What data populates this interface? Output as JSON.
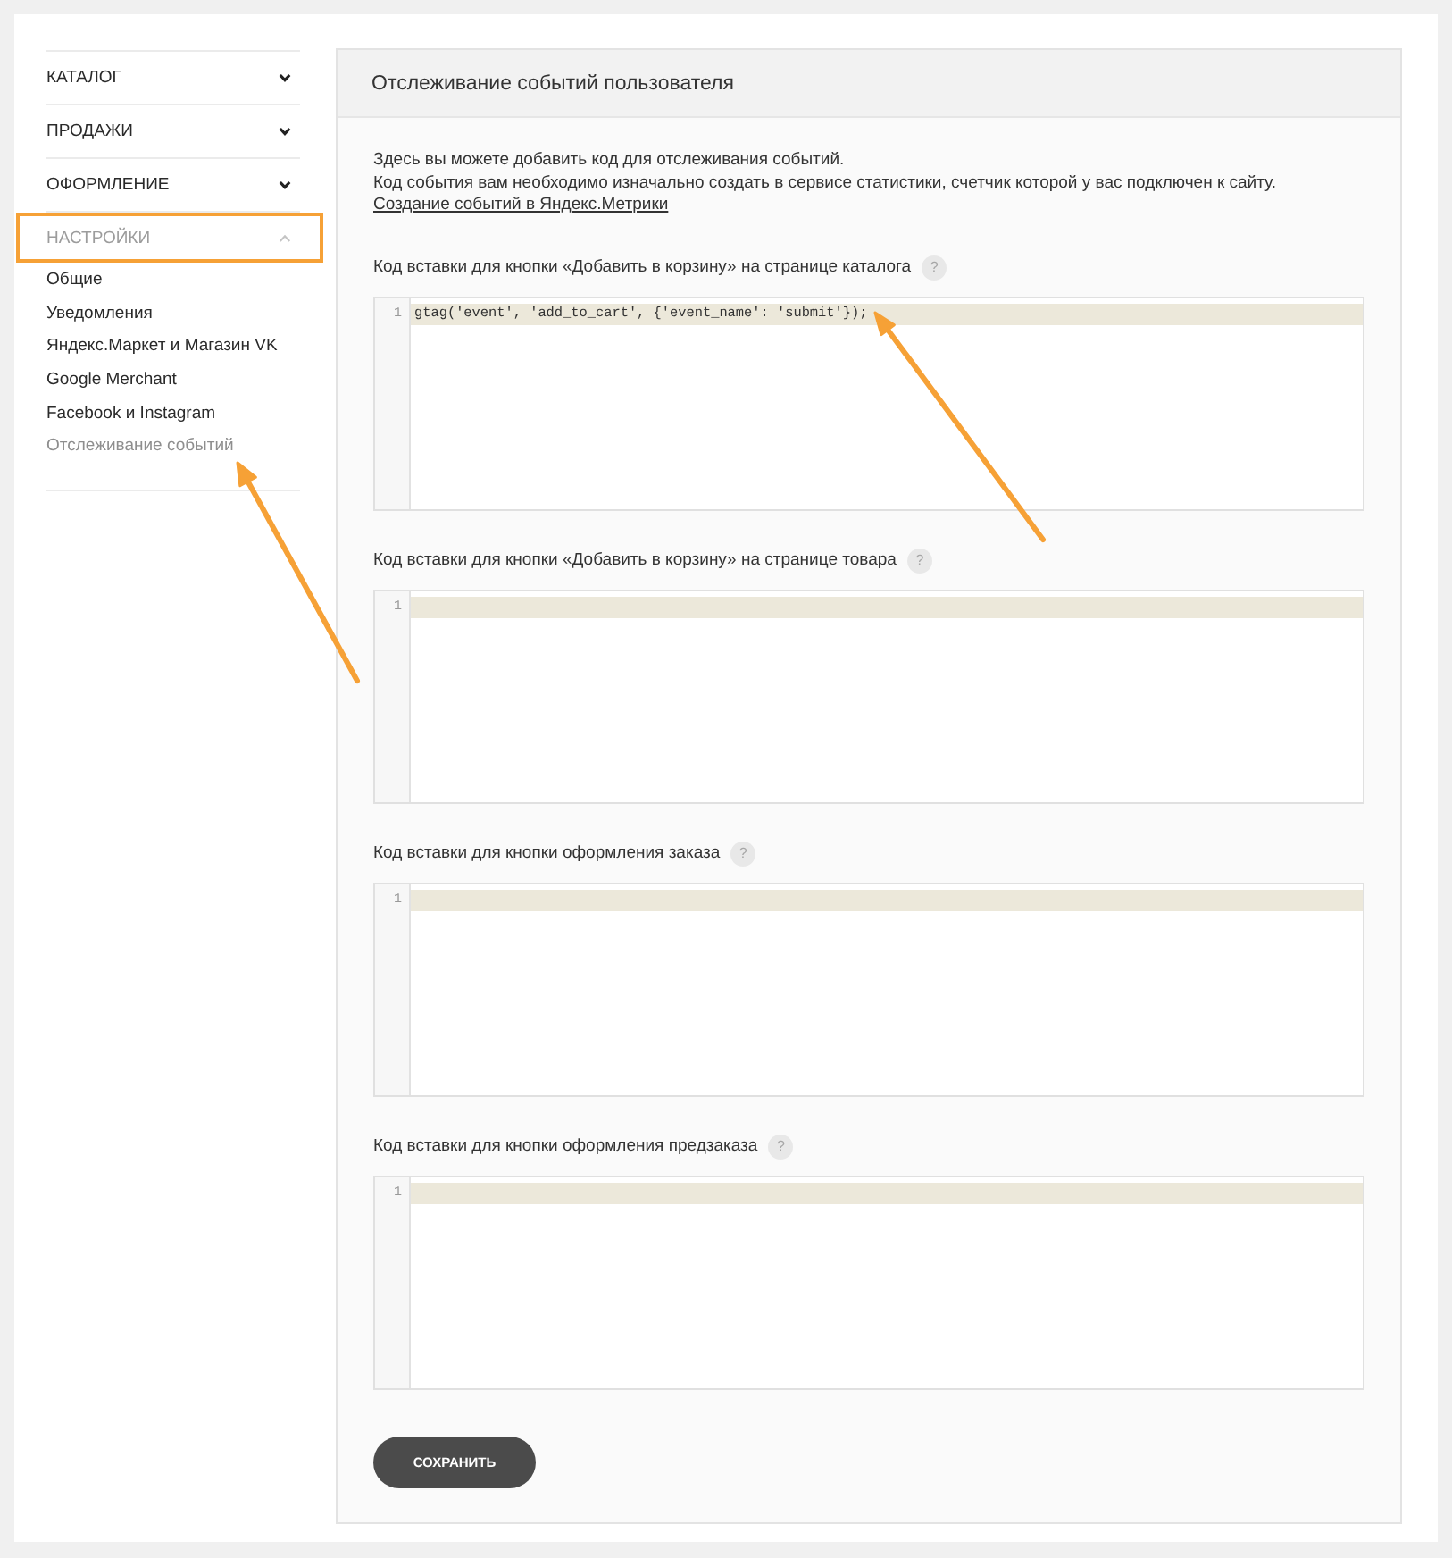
{
  "sidebar": {
    "sections": [
      {
        "label": "КАТАЛОГ",
        "expanded": false,
        "highlighted": false
      },
      {
        "label": "ПРОДАЖИ",
        "expanded": false,
        "highlighted": false
      },
      {
        "label": "ОФОРМЛЕНИЕ",
        "expanded": false,
        "highlighted": false
      },
      {
        "label": "НАСТРОЙКИ",
        "expanded": true,
        "highlighted": true,
        "items": [
          {
            "label": "Общие",
            "selected": false,
            "arrow": false
          },
          {
            "label": "Уведомления",
            "selected": false,
            "arrow": false
          },
          {
            "label": "Яндекс.Маркет и Магазин VK",
            "selected": false,
            "arrow": false
          },
          {
            "label": "Google Merchant",
            "selected": false,
            "arrow": false
          },
          {
            "label": "Facebook и Instagram",
            "selected": false,
            "arrow": false
          },
          {
            "label": "Отслеживание событий",
            "selected": true,
            "arrow": true
          }
        ]
      }
    ]
  },
  "panel": {
    "title": "Отслеживание событий пользователя",
    "intro": [
      "Здесь вы можете добавить код для отслеживания событий.",
      "Код события вам необходимо изначально создать в сервисе статистики, счетчик которой у вас подключен к сайту."
    ],
    "link": "Создание событий в Яндекс.Метрики",
    "fields": [
      {
        "label": "Код вставки для кнопки «Добавить в корзину» на странице каталога",
        "help": "?",
        "lines": [
          {
            "number": "1",
            "code": "gtag('event', 'add_to_cart', {'event_name': 'submit'});",
            "active": true,
            "arrow": true
          }
        ]
      },
      {
        "label": "Код вставки для кнопки «Добавить в корзину» на странице товара",
        "help": "?",
        "lines": [
          {
            "number": "1",
            "active": true,
            "arrow": false
          }
        ]
      },
      {
        "label": "Код вставки для кнопки оформления заказа",
        "help": "?",
        "lines": [
          {
            "number": "1",
            "active": true,
            "arrow": false
          }
        ]
      },
      {
        "label": "Код вставки для кнопки оформления предзаказа",
        "help": "?",
        "lines": [
          {
            "number": "1",
            "active": true,
            "arrow": false
          }
        ]
      }
    ],
    "save_button": "СОХРАНИТЬ"
  }
}
